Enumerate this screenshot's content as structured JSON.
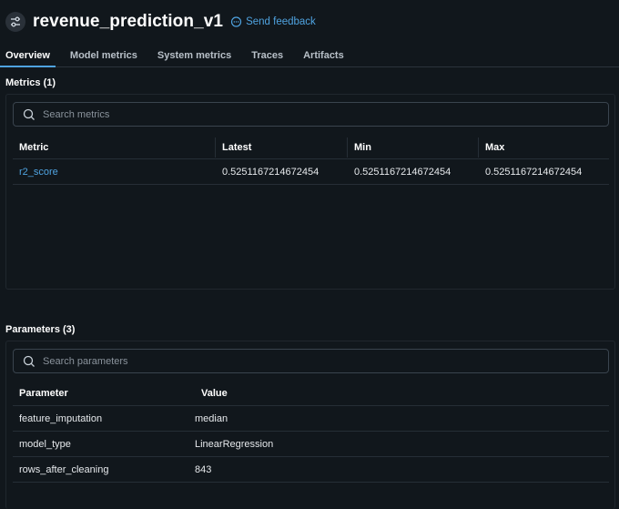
{
  "header": {
    "title": "revenue_prediction_v1",
    "feedback_label": "Send feedback"
  },
  "tabs": [
    {
      "label": "Overview",
      "active": true
    },
    {
      "label": "Model metrics"
    },
    {
      "label": "System metrics"
    },
    {
      "label": "Traces"
    },
    {
      "label": "Artifacts"
    }
  ],
  "metrics": {
    "section_title": "Metrics (1)",
    "search_placeholder": "Search metrics",
    "columns": [
      "Metric",
      "Latest",
      "Min",
      "Max"
    ],
    "rows": [
      {
        "metric": "r2_score",
        "latest": "0.5251167214672454",
        "min": "0.5251167214672454",
        "max": "0.5251167214672454"
      }
    ]
  },
  "parameters": {
    "section_title": "Parameters (3)",
    "search_placeholder": "Search parameters",
    "columns": [
      "Parameter",
      "Value"
    ],
    "rows": [
      {
        "parameter": "feature_imputation",
        "value": "median"
      },
      {
        "parameter": "model_type",
        "value": "LinearRegression"
      },
      {
        "parameter": "rows_after_cleaning",
        "value": "843"
      }
    ]
  },
  "colors": {
    "background": "#11171c",
    "accent": "#4fa3e0",
    "border": "#2c343c"
  }
}
